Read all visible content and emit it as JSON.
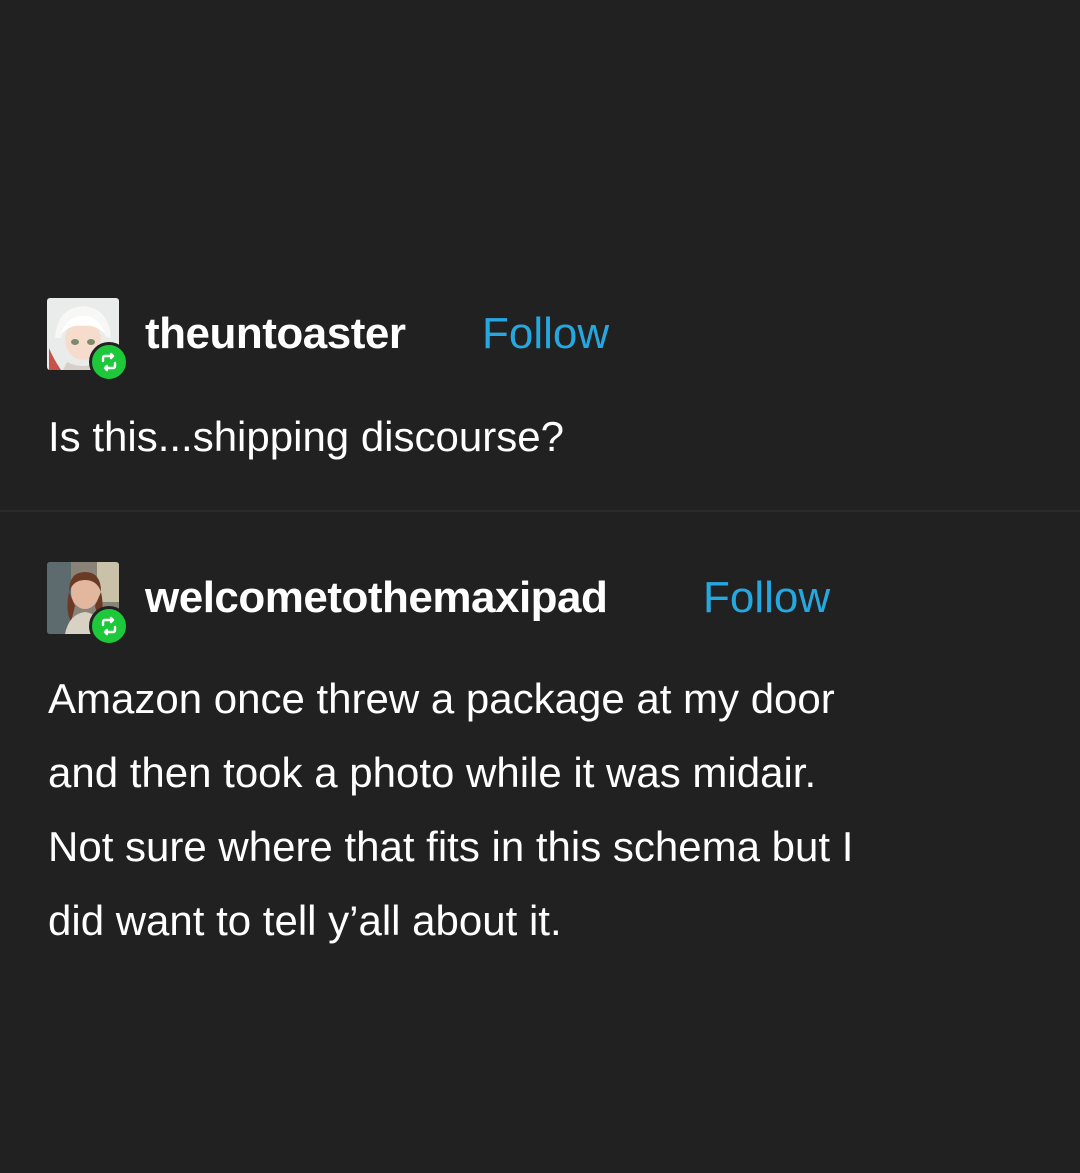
{
  "posts": [
    {
      "username": "theuntoaster",
      "follow_label": "Follow",
      "body_lines": [
        "Is this...shipping discourse?"
      ],
      "avatar_icon": "anime-character-avatar",
      "badge_icon": "reblog-icon"
    },
    {
      "username": "welcometothemaxipad",
      "follow_label": "Follow",
      "body_lines": [
        "Amazon once threw a package at my door",
        "and then took a photo while it was midair.",
        "Not sure where that fits in this schema but I",
        "did want to tell y’all about it."
      ],
      "avatar_icon": "person-photo-avatar",
      "badge_icon": "reblog-icon"
    }
  ],
  "colors": {
    "background": "#212121",
    "text": "#ffffff",
    "follow": "#25a8e0",
    "reblog_badge": "#1dc93b"
  }
}
